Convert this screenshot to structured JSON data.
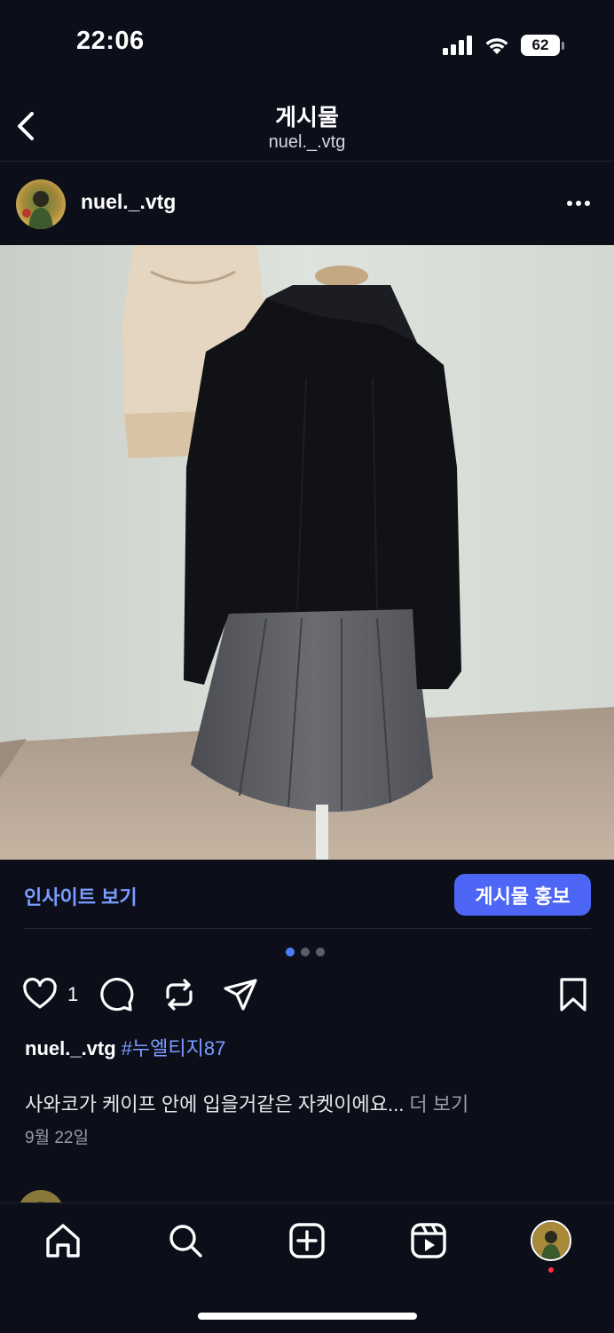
{
  "status_bar": {
    "time": "22:06",
    "battery": "62"
  },
  "header": {
    "title": "게시물",
    "subtitle": "nuel._.vtg"
  },
  "post": {
    "username": "nuel._.vtg",
    "like_count": "1",
    "caption_user": "nuel._.vtg",
    "hashtag": "#누엘티지87",
    "caption": "사와코가 케이프 안에 입을거같은 자켓이에요...",
    "more_label": "더 보기",
    "date": "9월 22일",
    "carousel": {
      "count": 3,
      "active": 0
    }
  },
  "insight": {
    "view_insights": "인사이트 보기",
    "promote_button": "게시물 홍보"
  },
  "icons": [
    "back-icon",
    "more-icon",
    "heart-icon",
    "comment-icon",
    "repost-icon",
    "share-icon",
    "bookmark-icon",
    "home-icon",
    "search-icon",
    "create-icon",
    "reels-icon",
    "profile-avatar"
  ],
  "colors": {
    "background": "#0c0f1a",
    "accent": "#4d66f5",
    "link": "#7b9cff"
  }
}
